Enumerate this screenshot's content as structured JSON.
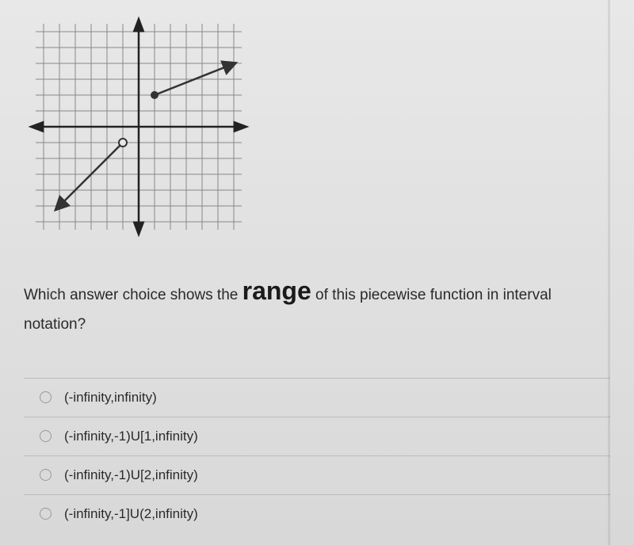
{
  "question": {
    "prefix": "Which answer choice shows the ",
    "emphasized": "range",
    "suffix": " of this piecewise function in interval notation?"
  },
  "options": [
    "(-infinity,infinity)",
    "(-infinity,-1)U[1,infinity)",
    "(-infinity,-1)U[2,infinity)",
    "(-infinity,-1]U(2,infinity)"
  ],
  "chart_data": {
    "type": "line",
    "title": "",
    "xlabel": "",
    "ylabel": "",
    "xlim": [
      -7,
      7
    ],
    "ylim": [
      -7,
      7
    ],
    "grid": true,
    "series": [
      {
        "name": "segment1",
        "points": [
          [
            -5,
            -5
          ],
          [
            -1,
            -1
          ]
        ],
        "start_marker": "arrow",
        "end_marker": "open",
        "style": "solid"
      },
      {
        "name": "segment2",
        "points": [
          [
            1,
            2
          ],
          [
            6,
            4
          ]
        ],
        "start_marker": "closed",
        "end_marker": "arrow",
        "style": "solid"
      }
    ]
  }
}
